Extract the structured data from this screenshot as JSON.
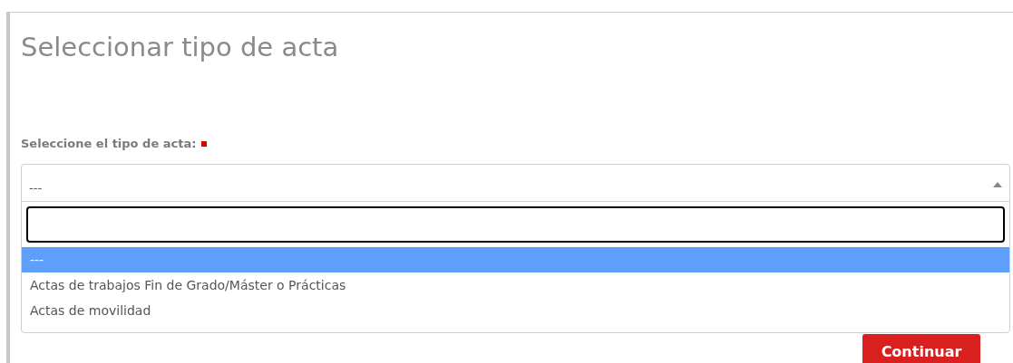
{
  "title": "Seleccionar tipo de acta",
  "field": {
    "label": "Seleccione el tipo de acta:",
    "required": true,
    "value": "---",
    "expanded": true
  },
  "options": [
    {
      "label": "---",
      "selected": true
    },
    {
      "label": "Actas de trabajos Fin de Grado/Máster o Prácticas",
      "selected": false
    },
    {
      "label": "Actas de movilidad",
      "selected": false
    }
  ],
  "button": "Continuar"
}
